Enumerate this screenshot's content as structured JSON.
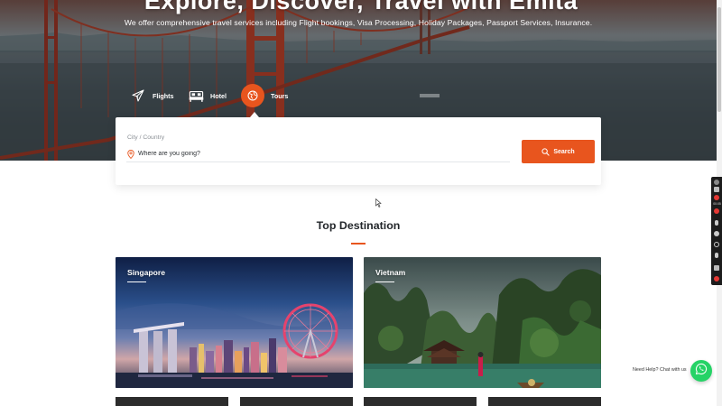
{
  "hero": {
    "title": "Explore, Discover, Travel with Emita",
    "subtitle": "We offer comprehensive travel services including Flight bookings, Visa Processing, Holiday Packages, Passport Services, Insurance."
  },
  "tabs": [
    {
      "label": "Flights",
      "icon": "airplane-icon"
    },
    {
      "label": "Hotel",
      "icon": "bed-icon"
    },
    {
      "label": "Tours",
      "icon": "map-icon",
      "active": true
    }
  ],
  "search": {
    "field_label": "City / Country",
    "placeholder": "Where are you going?",
    "button_label": "Search"
  },
  "destinations": {
    "title": "Top Destination",
    "items": [
      {
        "name": "Singapore"
      },
      {
        "name": "Vietnam"
      }
    ]
  },
  "chat": {
    "label": "Need Help? Chat with us"
  },
  "recorder": {
    "timer": "00:05"
  },
  "colors": {
    "accent": "#e8551e",
    "whatsapp": "#25d366",
    "text_dark": "#23272b"
  }
}
